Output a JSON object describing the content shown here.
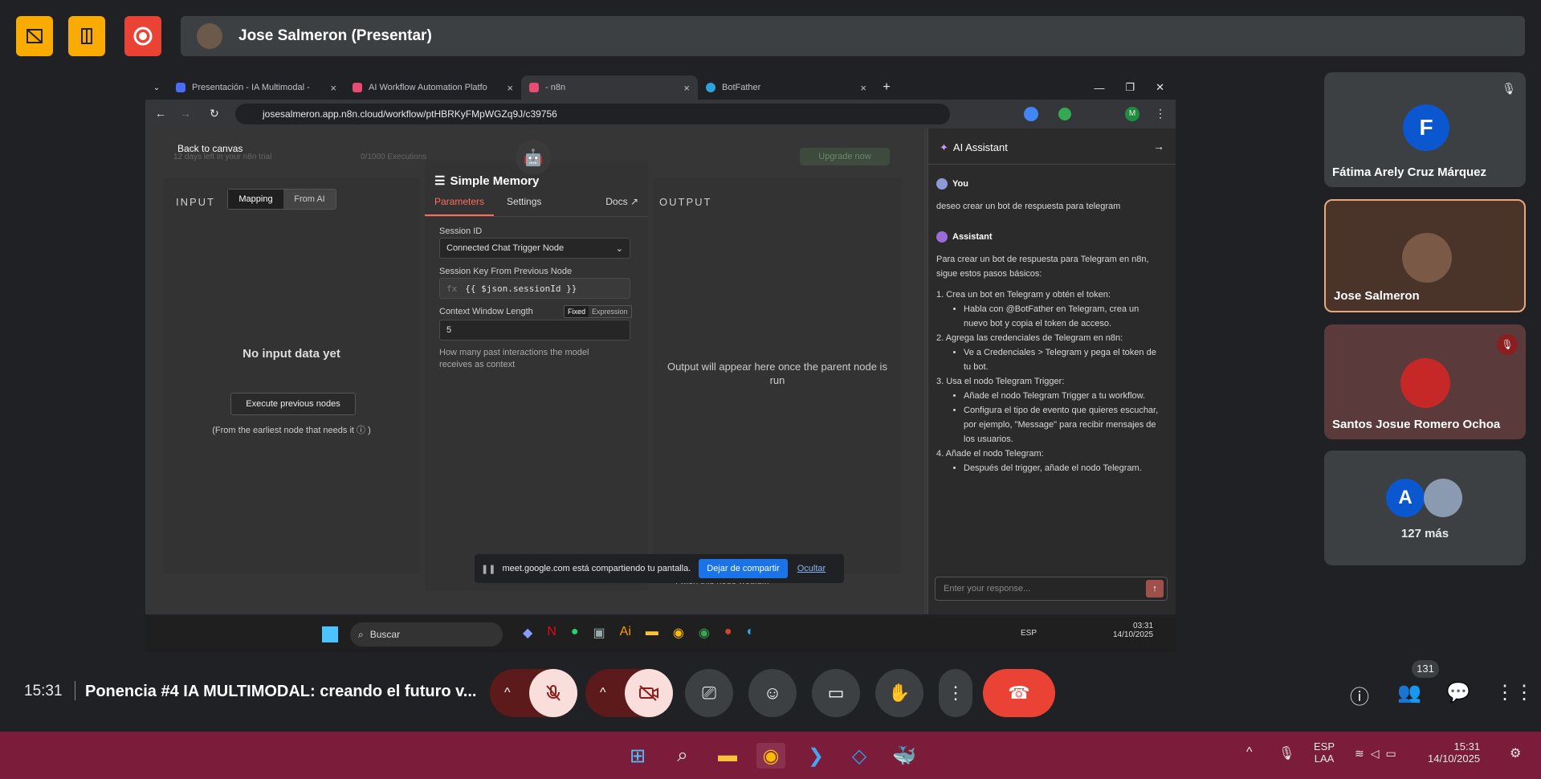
{
  "meet": {
    "presenter_label": "Jose Salmeron (Presentar)",
    "time": "15:31",
    "meeting_title": "Ponencia #4 IA MULTIMODAL: creando el futuro v...",
    "participant_count": "131",
    "participants": [
      {
        "initial": "F",
        "name": "Fátima Arely Cruz Márquez"
      },
      {
        "name": "Jose Salmeron"
      },
      {
        "name": "Santos Josue Romero Ochoa"
      },
      {
        "initial": "A",
        "name": "127 más"
      }
    ]
  },
  "browser": {
    "tabs": [
      {
        "label": "Presentación - IA Multimodal -"
      },
      {
        "label": "AI Workflow Automation Platfo"
      },
      {
        "label": "- n8n"
      },
      {
        "label": "BotFather"
      }
    ],
    "url": "josesalmeron.app.n8n.cloud/workflow/ptHBRKyFMpWGZq9J/c39756"
  },
  "n8n": {
    "back_to_canvas": "Back to canvas",
    "trial_text": "12 days left in your n8n trial",
    "executions": "0/1000 Executions",
    "upgrade": "Upgrade now",
    "input": {
      "header": "INPUT",
      "mode_mapping": "Mapping",
      "mode_fromai": "From AI",
      "empty": "No input data yet",
      "execute_btn": "Execute previous nodes",
      "hint": "(From the earliest node that needs it ⓘ )"
    },
    "node": {
      "title": "Simple Memory",
      "tab_parameters": "Parameters",
      "tab_settings": "Settings",
      "tab_docs": "Docs",
      "session_id_label": "Session ID",
      "session_id_value": "Connected Chat Trigger Node",
      "session_key_label": "Session Key From Previous Node",
      "session_key_value": "{{ $json.sessionId }}",
      "context_label": "Context Window Length",
      "fixed": "Fixed",
      "expression": "Expression",
      "context_value": "5",
      "context_hint": "How many past interactions the model receives as context"
    },
    "output": {
      "header": "OUTPUT",
      "empty": "Output will appear here once the parent node is run",
      "wish": "I wish this node would..."
    },
    "share_banner": {
      "text": "meet.google.com está compartiendo tu pantalla.",
      "stop": "Dejar de compartir",
      "hide": "Ocultar"
    },
    "assistant": {
      "title": "AI Assistant",
      "you": "You",
      "user_msg": "deseo crear un bot de respuesta para telegram",
      "assistant_label": "Assistant",
      "intro": "Para crear un bot de respuesta para Telegram en n8n, sigue estos pasos básicos:",
      "steps": [
        {
          "title": "1. Crea un bot en Telegram y obtén el token:",
          "items": [
            "Habla con @BotFather en Telegram, crea un nuevo bot y copia el token de acceso."
          ]
        },
        {
          "title": "2. Agrega las credenciales de Telegram en n8n:",
          "items": [
            "Ve a Credenciales > Telegram y pega el token de tu bot."
          ]
        },
        {
          "title": "3. Usa el nodo Telegram Trigger:",
          "items": [
            "Añade el nodo Telegram Trigger a tu workflow.",
            "Configura el tipo de evento que quieres escuchar, por ejemplo, \"Message\" para recibir mensajes de los usuarios."
          ]
        },
        {
          "title": "4. Añade el nodo Telegram:",
          "items": [
            "Después del trigger, añade el nodo Telegram."
          ]
        }
      ],
      "placeholder": "Enter your response..."
    }
  },
  "inner_taskbar": {
    "search": "Buscar",
    "lang": "ESP",
    "time": "03:31",
    "date": "14/10/2025"
  },
  "taskbar": {
    "lang1": "ESP",
    "lang2": "LAA",
    "time": "15:31",
    "date": "14/10/2025"
  }
}
